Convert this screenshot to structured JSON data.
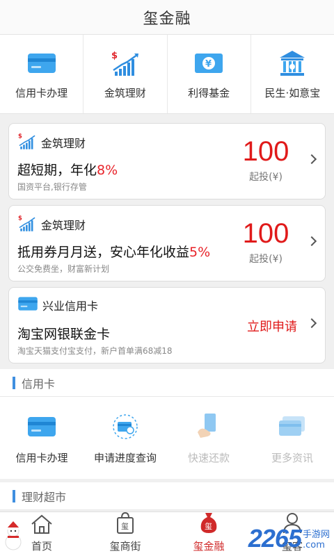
{
  "header": {
    "title": "玺金融"
  },
  "quick": [
    {
      "label": "信用卡办理",
      "icon": "credit-card-icon"
    },
    {
      "label": "金筑理财",
      "icon": "growth-chart-icon"
    },
    {
      "label": "利得基金",
      "icon": "yuan-bill-icon"
    },
    {
      "label": "民生·如意宝",
      "icon": "bank-building-icon"
    }
  ],
  "cards": [
    {
      "brand": "金筑理财",
      "title": "超短期，年化",
      "rate": "8%",
      "sub": "国资平台,银行存管",
      "amount": "100",
      "unit": "起投(¥)"
    },
    {
      "brand": "金筑理财",
      "title": "抵用券月月送，安心年化收益",
      "rate": "5%",
      "sub": "公交免费坐，财富新计划",
      "amount": "100",
      "unit": "起投(¥)"
    },
    {
      "brand": "兴业信用卡",
      "title": "淘宝网银联金卡",
      "sub": "淘宝天猫支付宝支付，新户首单满68减18",
      "action": "立即申请"
    }
  ],
  "credit_section": {
    "title": "信用卡",
    "items": [
      {
        "label": "信用卡办理",
        "icon": "credit-card-icon"
      },
      {
        "label": "申请进度查询",
        "icon": "progress-query-icon"
      },
      {
        "label": "快速还款",
        "icon": "quick-repay-icon"
      },
      {
        "label": "更多资讯",
        "icon": "more-info-icon"
      }
    ]
  },
  "finance_section": {
    "title": "理财超市"
  },
  "tabbar": [
    {
      "label": "首页",
      "icon": "home-icon"
    },
    {
      "label": "玺商街",
      "icon": "shopping-bag-icon"
    },
    {
      "label": "玺金融",
      "icon": "money-bag-icon"
    },
    {
      "label": "玺客",
      "icon": "user-icon"
    }
  ],
  "watermark": {
    "number": "2265",
    "text": "手游网",
    "domain": ".com"
  },
  "colors": {
    "accent_red": "#e01a1a",
    "accent_blue": "#3f8fe0"
  }
}
